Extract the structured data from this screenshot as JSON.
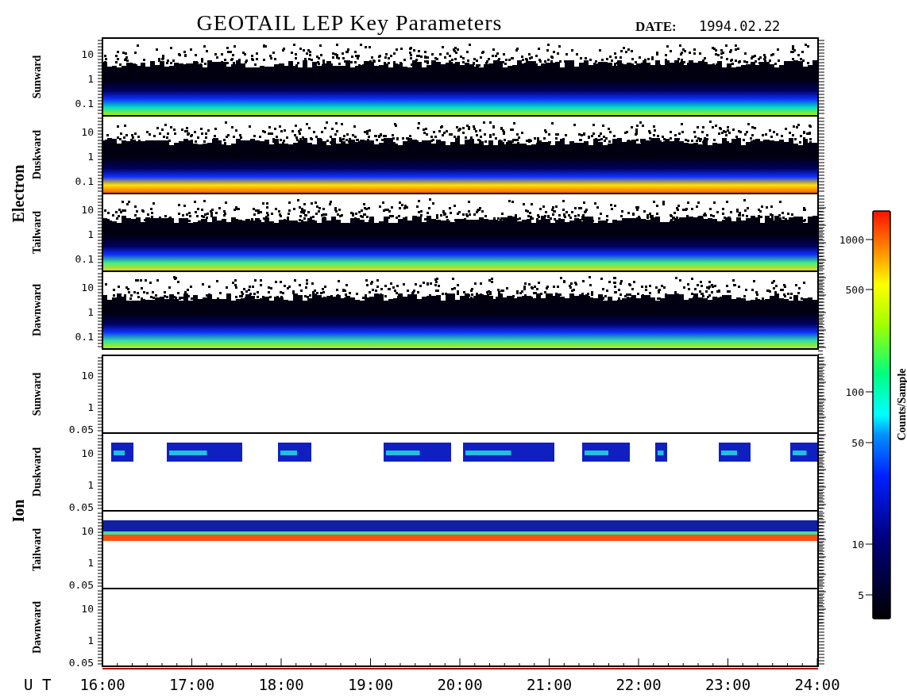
{
  "title": "GEOTAIL LEP Key Parameters",
  "date_label": "DATE:",
  "date": "1994.02.22",
  "groups": [
    {
      "name": "Electron",
      "kind": "electron",
      "panels": [
        {
          "label": "Sunward",
          "yticks": [
            "10",
            "1",
            "0.1"
          ]
        },
        {
          "label": "Duskward",
          "yticks": [
            "10",
            "1",
            "0.1"
          ]
        },
        {
          "label": "Tailward",
          "yticks": [
            "10",
            "1",
            "0.1"
          ]
        },
        {
          "label": "Dawnward",
          "yticks": [
            "10",
            "1",
            "0.1"
          ]
        }
      ]
    },
    {
      "name": "Ion",
      "kind": "ion",
      "panels": [
        {
          "label": "Sunward",
          "yticks": [
            "10",
            "1",
            "0.05"
          ]
        },
        {
          "label": "Duskward",
          "yticks": [
            "10",
            "1",
            "0.05"
          ]
        },
        {
          "label": "Tailward",
          "yticks": [
            "10",
            "1",
            "0.05"
          ]
        },
        {
          "label": "Dawnward",
          "yticks": [
            "10",
            "1",
            "0.05"
          ]
        }
      ]
    }
  ],
  "x_axis": {
    "label": "U T",
    "ticks": [
      "16:00",
      "17:00",
      "18:00",
      "19:00",
      "20:00",
      "21:00",
      "22:00",
      "23:00",
      "24:00"
    ]
  },
  "colorbar": {
    "label": "Counts/Sample",
    "ticks": [
      "1000",
      "500",
      "100",
      "50",
      "10",
      "5"
    ]
  }
}
